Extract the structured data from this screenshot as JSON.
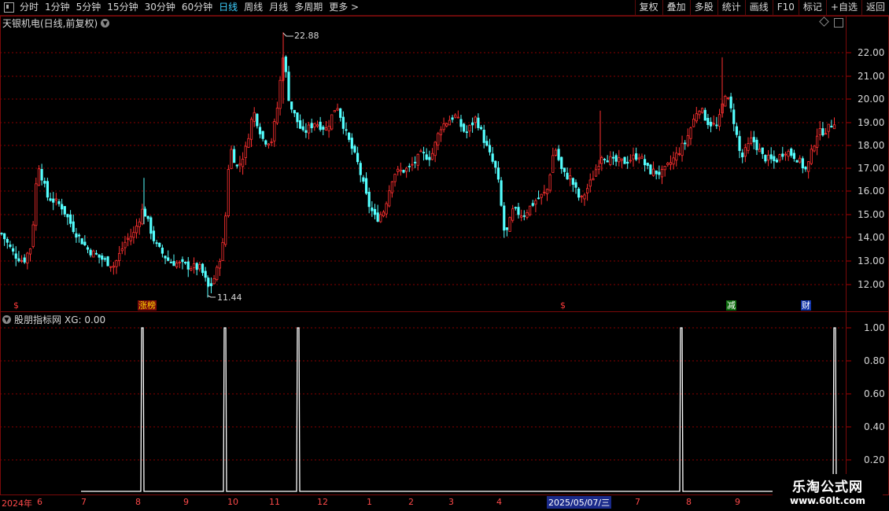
{
  "toolbar": {
    "left": [
      "分时",
      "1分钟",
      "5分钟",
      "15分钟",
      "30分钟",
      "60分钟",
      "日线",
      "周线",
      "月线",
      "多周期",
      "更多 >"
    ],
    "active": "日线",
    "right": [
      "复权",
      "叠加",
      "多股",
      "统计",
      "画线",
      "F10",
      "标记",
      "+自选",
      "返回"
    ]
  },
  "main": {
    "title": "天银机电(日线,前复权)",
    "high_label": "22.88",
    "low_label": "11.44",
    "price_ticks": [
      "22.00",
      "21.00",
      "20.00",
      "19.00",
      "18.00",
      "17.00",
      "16.00",
      "15.00",
      "14.00",
      "13.00",
      "12.00"
    ],
    "markers": [
      {
        "text": "$",
        "type": "dollar"
      },
      {
        "text": "涨榜",
        "type": "zb"
      },
      {
        "text": "$",
        "type": "dollar"
      },
      {
        "text": "减",
        "type": "jian"
      },
      {
        "text": "财",
        "type": "cai"
      }
    ]
  },
  "indicator": {
    "name": "股朋指标网",
    "xg_text": "XG: 0.00",
    "ticks": [
      "1.00",
      "0.80",
      "0.60",
      "0.40",
      "0.20"
    ]
  },
  "date_axis": {
    "year": "2024年",
    "labels": [
      "6",
      "7",
      "8",
      "9",
      "10",
      "11",
      "12",
      "1",
      "2",
      "3",
      "4",
      "5",
      "7",
      "8",
      "9"
    ],
    "current_date": "2025/05/07/三"
  },
  "watermark": {
    "line1": "乐淘公式网",
    "line2": "www.60lt.com"
  },
  "colors": {
    "up": "#ff3030",
    "down": "#54ffff",
    "grid": "#8a0000",
    "signal": "#ffffff"
  },
  "chart_data": {
    "type": "line",
    "title": "股朋指标网",
    "series": [
      {
        "name": "XG",
        "values": [
          0,
          1,
          0,
          1,
          0,
          1,
          0,
          1,
          0,
          1
        ]
      }
    ],
    "ylim": [
      0,
      1
    ],
    "price_range": [
      11.44,
      22.88
    ]
  }
}
